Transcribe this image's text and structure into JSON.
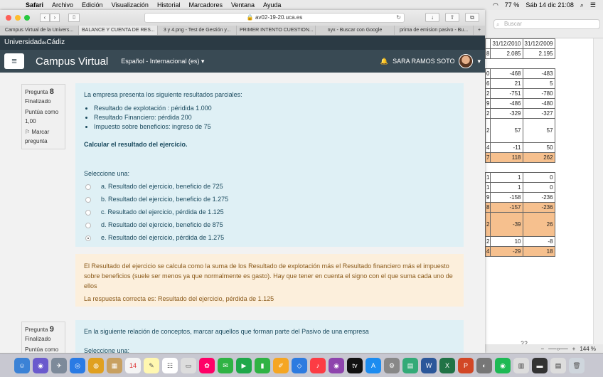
{
  "menubar": {
    "items": [
      "Safari",
      "Archivo",
      "Edición",
      "Visualización",
      "Historial",
      "Marcadores",
      "Ventana",
      "Ayuda"
    ],
    "battery": "77 %",
    "clock": "Sáb 14 dic  21:08"
  },
  "browser": {
    "url": "av02-19-20.uca.es",
    "tabs": [
      "Campus Virtual de la Univers...",
      "BALANCE Y CUENTA DE RES...",
      "3 y 4.png - Test de Gestión y...",
      "PRIMER INTENTO CUESTION...",
      "nyx - Buscar con Google",
      "prima de emision pasivo - Bu..."
    ],
    "active_tab": 1
  },
  "site": {
    "university": "Universidad",
    "university_small": "de",
    "university_end": "Cádiz",
    "title": "Campus Virtual",
    "language": "Español - Internacional (es)",
    "user": "SARA RAMOS SOTO"
  },
  "q8": {
    "label": "Pregunta",
    "number": "8",
    "status": "Finalizado",
    "score": "Puntúa como 1,00",
    "flag": "Marcar pregunta",
    "intro": "La empresa presenta los siguiente resultados parciales:",
    "bullets": [
      "Resultado de explotación : péridida 1.000",
      "Resultado Financiero: pérdida 200",
      "Impuesto sobre beneficios: ingreso de  75"
    ],
    "task": "Calcular el resultado del ejercicio.",
    "select_label": "Seleccione una:",
    "options": [
      "a. Resultado del ejercicio, beneficio de 725",
      "b. Resultado del ejercicio, beneficio de 1.275",
      "c. Resultado del ejercicio, pérdida de 1.125",
      "d. Resultado del ejercicio, beneficio de 875",
      "e. Resultado del ejercicio, pérdida de 1.275"
    ],
    "selected": 4,
    "feedback": "El Resultado del ejercicio se calcula como la suma de los Resultado de explotación más el Resultado financiero más el impuesto sobre beneficios (suele ser menos ya que normalmente es gasto). Hay que tener en cuenta el signo con el que suma cada uno de ellos",
    "correct": "La respuesta correcta es: Resultado del ejercicio, pérdida de 1.125"
  },
  "q9": {
    "label": "Pregunta",
    "number": "9",
    "status": "Finalizado",
    "score": "Puntúa como",
    "text": "En la siguiente relación de conceptos, marcar aquellos que forman parte del Pasivo  de una empresa",
    "select_label": "Seleccione una:"
  },
  "bgdoc": {
    "search_placeholder": "Buscar",
    "headers": [
      "31/12/2010",
      "31/12/2009"
    ],
    "rows": [
      {
        "a": "8",
        "b": "2.085",
        "c": "2.195",
        "hl": false
      },
      {
        "a": "",
        "b": "",
        "c": "",
        "hl": false,
        "gap": true
      },
      {
        "a": "0",
        "b": "-468",
        "c": "-483",
        "hl": false
      },
      {
        "a": "6",
        "b": "21",
        "c": "5",
        "hl": false
      },
      {
        "a": "2",
        "b": "-751",
        "c": "-780",
        "hl": false
      },
      {
        "a": "9",
        "b": "-486",
        "c": "-480",
        "hl": false
      },
      {
        "a": "2",
        "b": "-329",
        "c": "-327",
        "hl": false
      },
      {
        "a": "2",
        "b": "57",
        "c": "57",
        "hl": false,
        "tall": true
      },
      {
        "a": "4",
        "b": "-11",
        "c": "50",
        "hl": false
      },
      {
        "a": "7",
        "b": "118",
        "c": "262",
        "hl": true
      },
      {
        "a": "",
        "b": "",
        "c": "",
        "hl": false,
        "gap": true
      },
      {
        "a": "1",
        "b": "1",
        "c": "0",
        "hl": false
      },
      {
        "a": "1",
        "b": "1",
        "c": "0",
        "hl": false
      },
      {
        "a": "9",
        "b": "-158",
        "c": "-236",
        "hl": false
      },
      {
        "a": "8",
        "b": "-157",
        "c": "-236",
        "hl": true
      },
      {
        "a": "2",
        "b": "-39",
        "c": "26",
        "hl": true,
        "tall": true
      },
      {
        "a": "2",
        "b": "10",
        "c": "-8",
        "hl": false
      },
      {
        "a": "4",
        "b": "-29",
        "c": "18",
        "hl": true
      }
    ],
    "page": "22",
    "zoom": "144 %"
  }
}
